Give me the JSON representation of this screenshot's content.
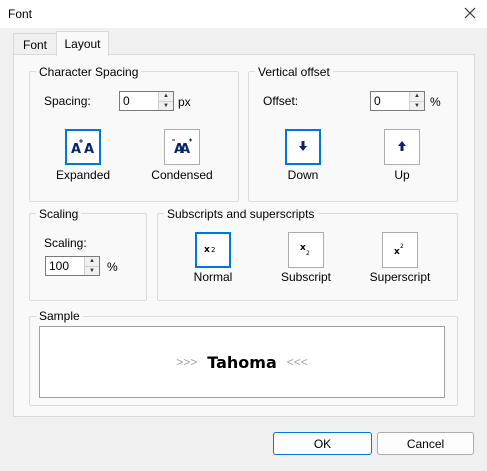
{
  "window": {
    "title": "Font"
  },
  "tabs": [
    {
      "label": "Font"
    },
    {
      "label": "Layout"
    }
  ],
  "character_spacing": {
    "title": "Character Spacing",
    "spacing_label": "Spacing:",
    "spacing_value": "0",
    "unit": "px",
    "expanded_label": "Expanded",
    "condensed_label": "Condensed"
  },
  "vertical_offset": {
    "title": "Vertical offset",
    "offset_label": "Offset:",
    "offset_value": "0",
    "unit": "%",
    "down_label": "Down",
    "up_label": "Up"
  },
  "scaling": {
    "title": "Scaling",
    "scaling_label": "Scaling:",
    "scaling_value": "100",
    "unit": "%"
  },
  "subscripts": {
    "title": "Subscripts and superscripts",
    "normal_label": "Normal",
    "subscript_label": "Subscript",
    "superscript_label": "Superscript"
  },
  "sample": {
    "title": "Sample",
    "left_marker": ">>>",
    "text": "Tahoma",
    "right_marker": "<<<"
  },
  "buttons": {
    "ok": "OK",
    "cancel": "Cancel"
  },
  "colors": {
    "accent": "#0078d7",
    "icon": "#0a246a"
  }
}
